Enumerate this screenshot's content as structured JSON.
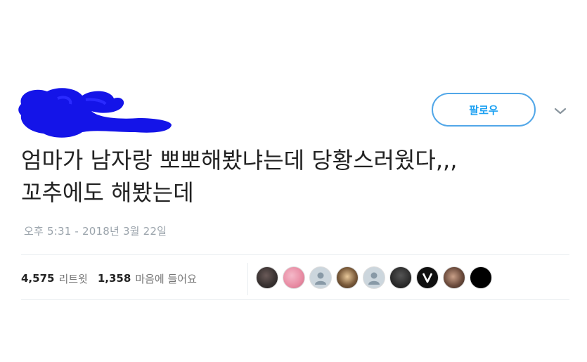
{
  "header": {
    "follow_label": "팔로우"
  },
  "tweet": {
    "line1": "엄마가 남자랑 뽀뽀해봤냐는데 당황스러웠다,,,",
    "line2": "꼬추에도 해봤는데",
    "timestamp": "오후 5:31 - 2018년 3월 22일"
  },
  "stats": {
    "retweets_count": "4,575",
    "retweets_label": "리트윗",
    "likes_count": "1,358",
    "likes_label": "마음에 들어요"
  },
  "icons": {
    "chevron": "chevron-down-icon",
    "default_avatar": "default-avatar-icon"
  },
  "avatars": [
    "photo",
    "photo",
    "default",
    "photo",
    "default",
    "photo",
    "logo-v",
    "photo",
    "black"
  ],
  "colors": {
    "follow_accent": "#1da1f2",
    "redaction": "#1414e8"
  }
}
